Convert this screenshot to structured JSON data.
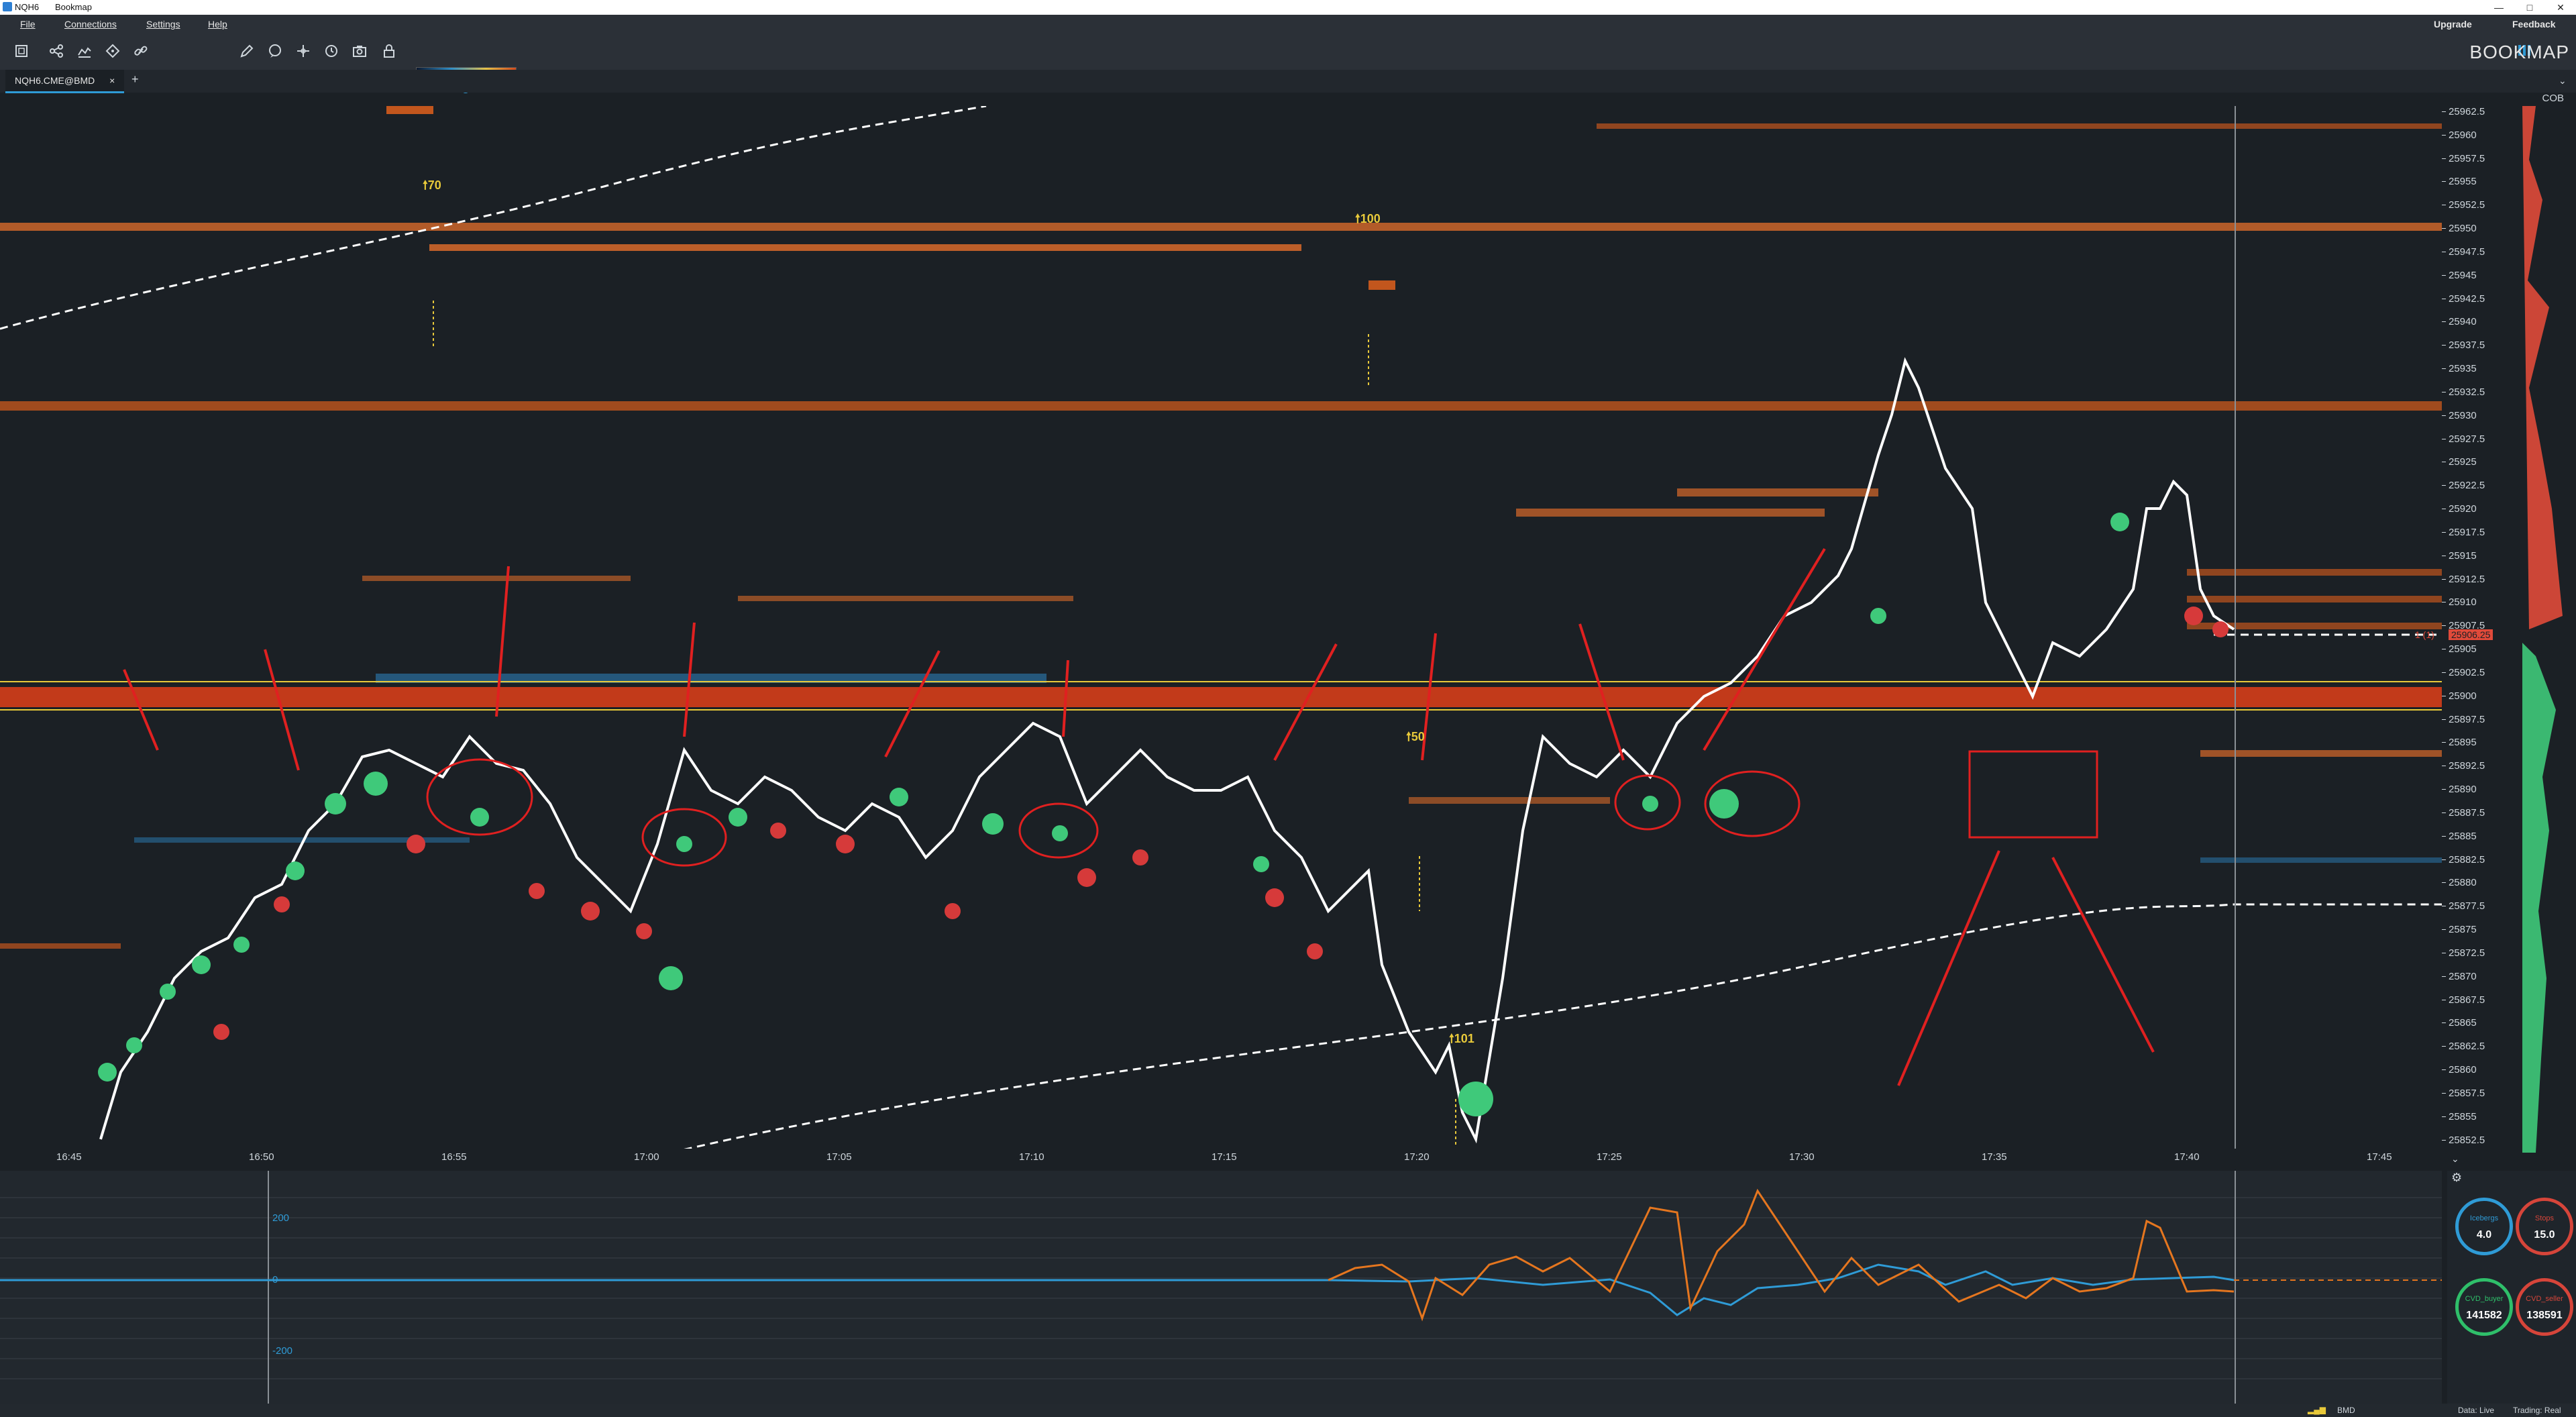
{
  "window": {
    "icon_text": "NQH6",
    "app_title": "Bookmap",
    "controls": [
      "—",
      "□",
      "✕"
    ]
  },
  "menu": {
    "items": [
      "File",
      "Connections",
      "Settings",
      "Help"
    ],
    "upgrade": "Upgrade",
    "feedback": "Feedback"
  },
  "toolbar": {
    "icons": [
      "fit-icon",
      "share-icon",
      "layers-icon",
      "crosshair-icon",
      "link-icon",
      "pencil-icon",
      "chat-icon",
      "target-icon",
      "clock-icon",
      "camera-icon",
      "lock-icon"
    ],
    "logo_text": "BOOKMAP",
    "heatmap_contrast": 0.6,
    "heatmap_zoom": 0.4,
    "colorbar": {
      "from": "#0b1830",
      "mid1": "#2f8fc9",
      "mid2": "#e7c248",
      "to": "#d24a1d"
    }
  },
  "tabs": [
    {
      "label": "NQH6.CME@BMD",
      "close": "×"
    }
  ],
  "add_tab": "+",
  "cob_label": "COB",
  "price_axis": [
    "25962.5",
    "25960",
    "25957.5",
    "25955",
    "25952.5",
    "25950",
    "25947.5",
    "25945",
    "25942.5",
    "25940",
    "25937.5",
    "25935",
    "25932.5",
    "25930",
    "25927.5",
    "25925",
    "25922.5",
    "25920",
    "25917.5",
    "25915",
    "25912.5",
    "25910",
    "25907.5",
    "25905",
    "25902.5",
    "25900",
    "25897.5",
    "25895",
    "25892.5",
    "25890",
    "25887.5",
    "25885",
    "25882.5",
    "25880",
    "25877.5",
    "25875",
    "25872.5",
    "25870",
    "25867.5",
    "25865",
    "25862.5",
    "25860",
    "25857.5",
    "25855",
    "25852.5"
  ],
  "current_price_marker": "25906.25",
  "position_label": "1 (1)",
  "time_axis": [
    "16:45",
    "16:50",
    "16:55",
    "17:00",
    "17:05",
    "17:10",
    "17:15",
    "17:20",
    "17:25",
    "17:30",
    "17:35",
    "17:40",
    "17:45"
  ],
  "trade_labels": [
    "70",
    "100",
    "50",
    "101"
  ],
  "indicator": {
    "ticks": [
      "200",
      "0",
      "-200"
    ]
  },
  "gauges": [
    {
      "name": "Icebergs",
      "value": "4.0",
      "color": "#2f9bd6"
    },
    {
      "name": "Stops",
      "value": "15.0",
      "color": "#d6453a"
    },
    {
      "name": "CVD_buyer",
      "value": "141582",
      "color": "#2fbf6a"
    },
    {
      "name": "CVD_seller",
      "value": "138591",
      "color": "#d6453a"
    }
  ],
  "status": {
    "connection": "BMD",
    "data": "Data: Live",
    "trading": "Trading: Real"
  },
  "colors": {
    "buy": "#3fc97a",
    "sell": "#d63a3a",
    "price_line": "#ffffff",
    "liquidity_high": "#d86a2a",
    "liquidity_low": "#2a6fa0",
    "annotation": "#e02020",
    "cvd": "#2f9bd6",
    "cvd_alt": "#e5761f"
  }
}
